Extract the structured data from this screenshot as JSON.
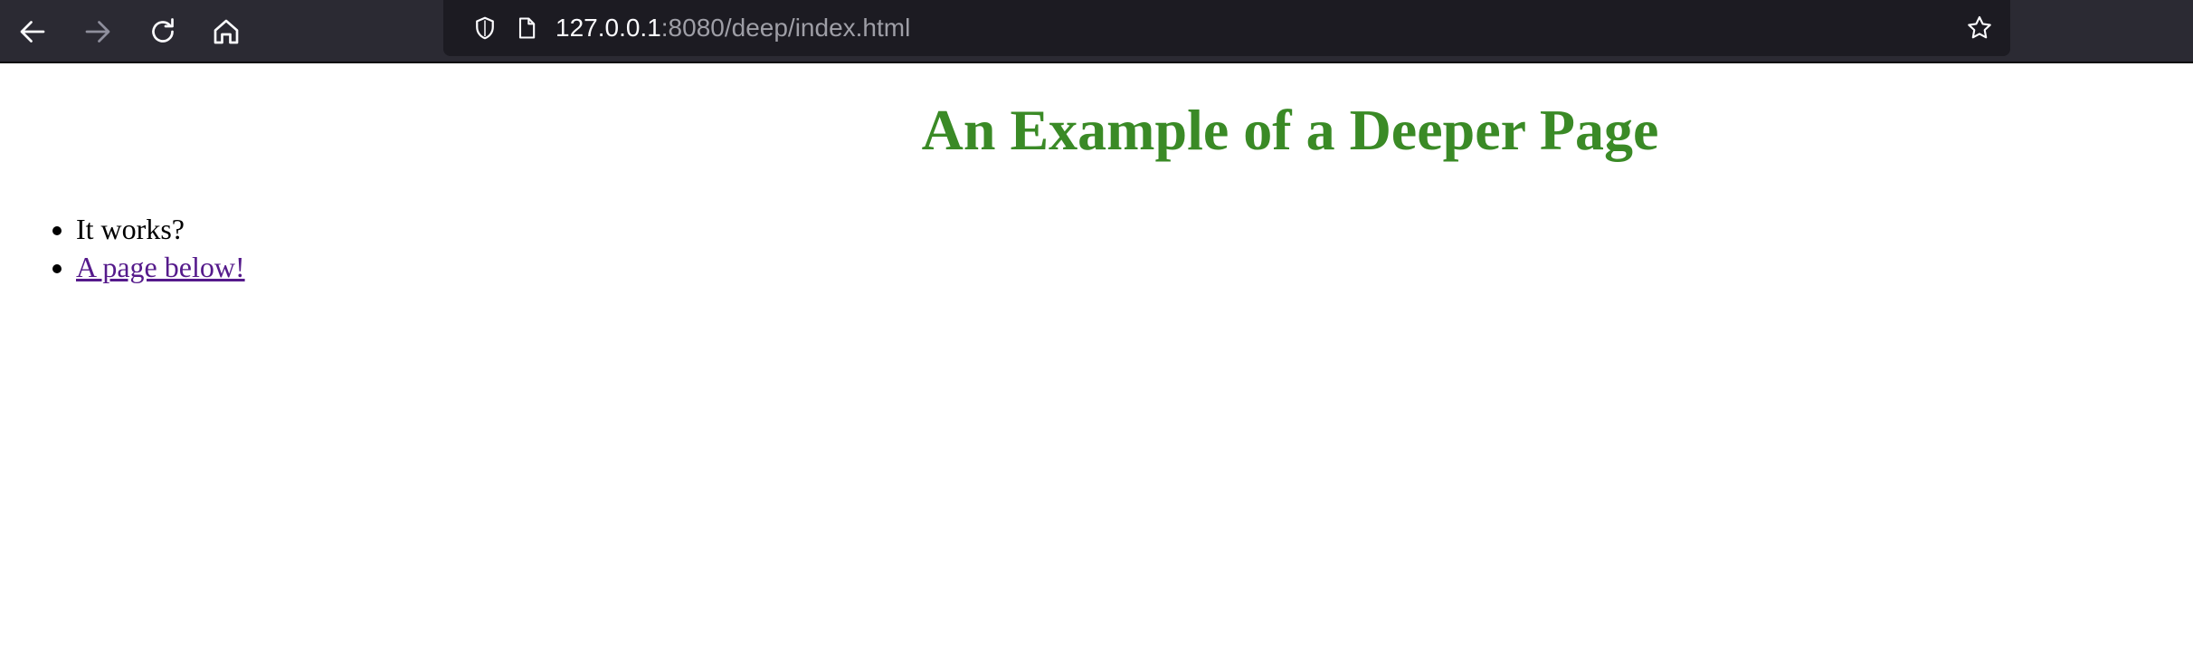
{
  "browser": {
    "nav": {
      "back_icon": "arrow-left-icon",
      "forward_icon": "arrow-right-icon",
      "reload_icon": "reload-icon",
      "home_icon": "home-icon"
    },
    "urlbar": {
      "shield_icon": "shield-icon",
      "page_icon": "page-icon",
      "url_host": "127.0.0.1",
      "url_rest": ":8080/deep/index.html",
      "bookmark_icon": "star-icon"
    },
    "colors": {
      "toolbar_bg": "#2b2a33",
      "urlbar_bg": "#1c1b22"
    }
  },
  "page": {
    "heading": "An Example of a Deeper Page",
    "heading_color": "#3a8a26",
    "list": [
      {
        "text": "It works?",
        "is_link": false
      },
      {
        "text": "A page below!",
        "is_link": true
      }
    ],
    "link_color": "#551a8b"
  }
}
